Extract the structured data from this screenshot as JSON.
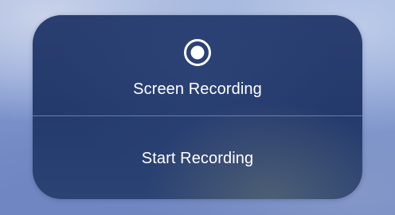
{
  "panel": {
    "icon": "record-icon",
    "title": "Screen Recording",
    "action_label": "Start Recording"
  },
  "colors": {
    "panel": "#263c6d",
    "text": "#ffffff",
    "divider": "#bfcdeb"
  }
}
